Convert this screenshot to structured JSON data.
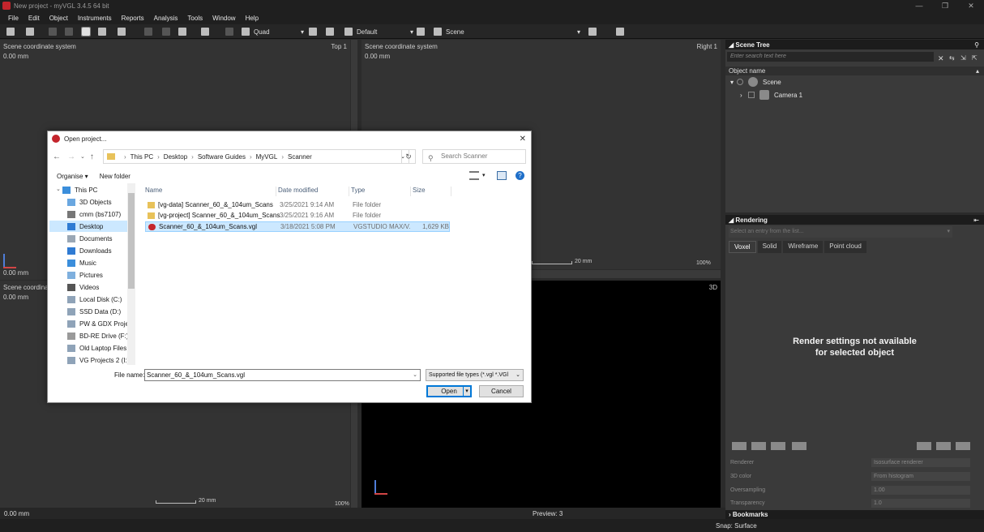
{
  "app": {
    "title": "New project - myVGL 3.4.5 64 bit"
  },
  "window_buttons": [
    "—",
    "❒",
    "✕"
  ],
  "menu": [
    "File",
    "Edit",
    "Object",
    "Instruments",
    "Reports",
    "Analysis",
    "Tools",
    "Window",
    "Help"
  ],
  "toolbar": {
    "layout": "Quad",
    "layout_preset": "Default",
    "scene_selector": "Scene"
  },
  "viewports": {
    "top_left": {
      "coord_label": "Scene coordinate system",
      "coord_value": "0.00 mm",
      "name": "Top 1",
      "offset": "0.00 mm"
    },
    "top_right": {
      "coord_label": "Scene coordinate system",
      "coord_value": "0.00 mm",
      "name": "Right 1",
      "scale": "20 mm",
      "zoom": "100%"
    },
    "bottom_left": {
      "coord_label": "Scene coordinat",
      "coord_value": "0.00 mm",
      "scale": "20 mm",
      "zoom": "100%"
    },
    "bottom_right": {
      "name": "3D"
    }
  },
  "scene_tree": {
    "title": "Scene Tree",
    "search_placeholder": "Enter search text here",
    "column": "Object name",
    "items": [
      "Scene",
      "Camera 1"
    ]
  },
  "rendering": {
    "title": "Rendering",
    "entry_placeholder": "Select an entry from the list...",
    "tabs": [
      "Voxel",
      "Solid",
      "Wireframe",
      "Point cloud"
    ],
    "message_line1": "Render settings not available",
    "message_line2": "for selected object",
    "props": [
      {
        "label": "Renderer",
        "value": "Isosurface renderer"
      },
      {
        "label": "3D color",
        "value": "From histogram"
      },
      {
        "label": "Oversampling",
        "value": "1.00"
      },
      {
        "label": "Transparency",
        "value": "1.0"
      }
    ]
  },
  "bookmarks": {
    "title": "Bookmarks"
  },
  "status": {
    "coord_value": "0.00 mm",
    "preview": "Preview: 3",
    "snap": "Snap: Surface"
  },
  "dialog": {
    "title": "Open project...",
    "breadcrumb": [
      "This PC",
      "Desktop",
      "Software Guides",
      "MyVGL",
      "Scanner"
    ],
    "search_placeholder": "Search Scanner",
    "organise": "Organise ▾",
    "new_folder": "New folder",
    "nav_items": [
      "This PC",
      "3D Objects",
      "cmm (bs7107)",
      "Desktop",
      "Documents",
      "Downloads",
      "Music",
      "Pictures",
      "Videos",
      "Local Disk (C:)",
      "SSD Data (D:)",
      "PW & GDX Projec",
      "BD-RE Drive (F:)",
      "Old Laptop Files (",
      "VG Projects 2 (I:)"
    ],
    "columns": {
      "name": "Name",
      "date": "Date modified",
      "type": "Type",
      "size": "Size"
    },
    "files": [
      {
        "name": "[vg-data] Scanner_60_&_104um_Scans",
        "date": "3/25/2021 9:14 AM",
        "type": "File folder",
        "size": ""
      },
      {
        "name": "[vg-project] Scanner_60_&_104um_Scans",
        "date": "3/25/2021 9:16 AM",
        "type": "File folder",
        "size": ""
      },
      {
        "name": "Scanner_60_&_104um_Scans.vgl",
        "date": "3/18/2021 5:08 PM",
        "type": "VGSTUDIO MAX/V...",
        "size": "1,629 KB"
      }
    ],
    "file_name_label": "File name:",
    "file_name_value": "Scanner_60_&_104um_Scans.vgl",
    "file_type": "Supported file types (*.vgl *.VGl",
    "open_button": "Open",
    "cancel_button": "Cancel"
  }
}
